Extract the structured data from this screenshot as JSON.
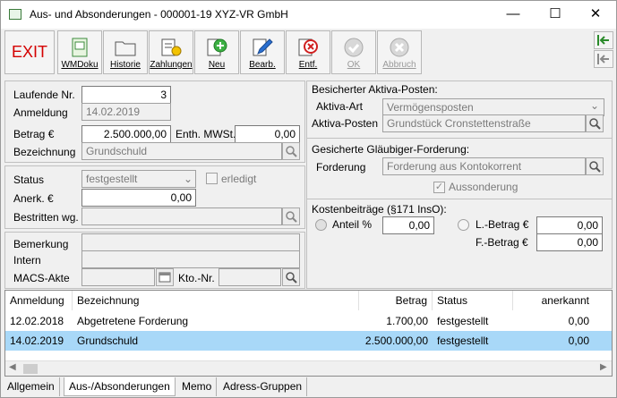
{
  "window": {
    "title": "Aus- und Absonderungen - 000001-19 XYZ-VR GmbH",
    "minimize": "—",
    "maximize": "☐",
    "close": "✕"
  },
  "toolbar": {
    "exit": "EXIT",
    "buttons": [
      {
        "label": "WMDoku"
      },
      {
        "label": "Historie"
      },
      {
        "label": "Zahlungen"
      },
      {
        "label": "Neu"
      },
      {
        "label": "Bearb."
      },
      {
        "label": "Entf."
      },
      {
        "label": "OK"
      },
      {
        "label": "Abbruch"
      }
    ]
  },
  "left": {
    "laufende_nr_label": "Laufende Nr.",
    "laufende_nr": "3",
    "anmeldung_label": "Anmeldung",
    "anmeldung": "14.02.2019",
    "betrag_label": "Betrag €",
    "betrag": "2.500.000,00",
    "mwst_label": "Enth. MWSt.",
    "mwst": "0,00",
    "bezeichnung_label": "Bezeichnung",
    "bezeichnung": "Grundschuld",
    "status_label": "Status",
    "status": "festgestellt",
    "erledigt_label": "erledigt",
    "anerk_label": "Anerk. €",
    "anerk": "0,00",
    "bestritten_label": "Bestritten wg.",
    "bestritten": "",
    "bemerkung_label": "Bemerkung",
    "intern_label": "Intern",
    "macs_label": "MACS-Akte",
    "kto_label": "Kto.-Nr."
  },
  "right": {
    "aktiva_title": "Besicherter Aktiva-Posten:",
    "aktiva_art_label": "Aktiva-Art",
    "aktiva_art": "Vermögensposten",
    "aktiva_posten_label": "Aktiva-Posten",
    "aktiva_posten": "Grundstück Cronstettenstraße",
    "glaeubiger_title": "Gesicherte Gläubiger-Forderung:",
    "forderung_label": "Forderung",
    "forderung": "Forderung aus Kontokorrent",
    "aussonderung_label": "Aussonderung",
    "kosten_title": "Kostenbeiträge (§171 InsO):",
    "anteil_label": "Anteil %",
    "anteil": "0,00",
    "lbetrag_label": "L.-Betrag €",
    "lbetrag": "0,00",
    "fbetrag_label": "F.-Betrag €",
    "fbetrag": "0,00"
  },
  "table": {
    "columns": [
      "Anmeldung",
      "Bezeichnung",
      "Betrag",
      "Status",
      "anerkannt"
    ],
    "rows": [
      [
        "12.02.2018",
        "Abgetretene Forderung",
        "1.700,00",
        "festgestellt",
        "0,00"
      ],
      [
        "14.02.2019",
        "Grundschuld",
        "2.500.000,00",
        "festgestellt",
        "0,00"
      ]
    ]
  },
  "tabs": [
    "Allgemein",
    "Aus-/Absonderungen",
    "Memo",
    "Adress-Gruppen"
  ],
  "colors": {
    "selected_row": "#a8d8f8",
    "exit_red": "#d40000"
  }
}
